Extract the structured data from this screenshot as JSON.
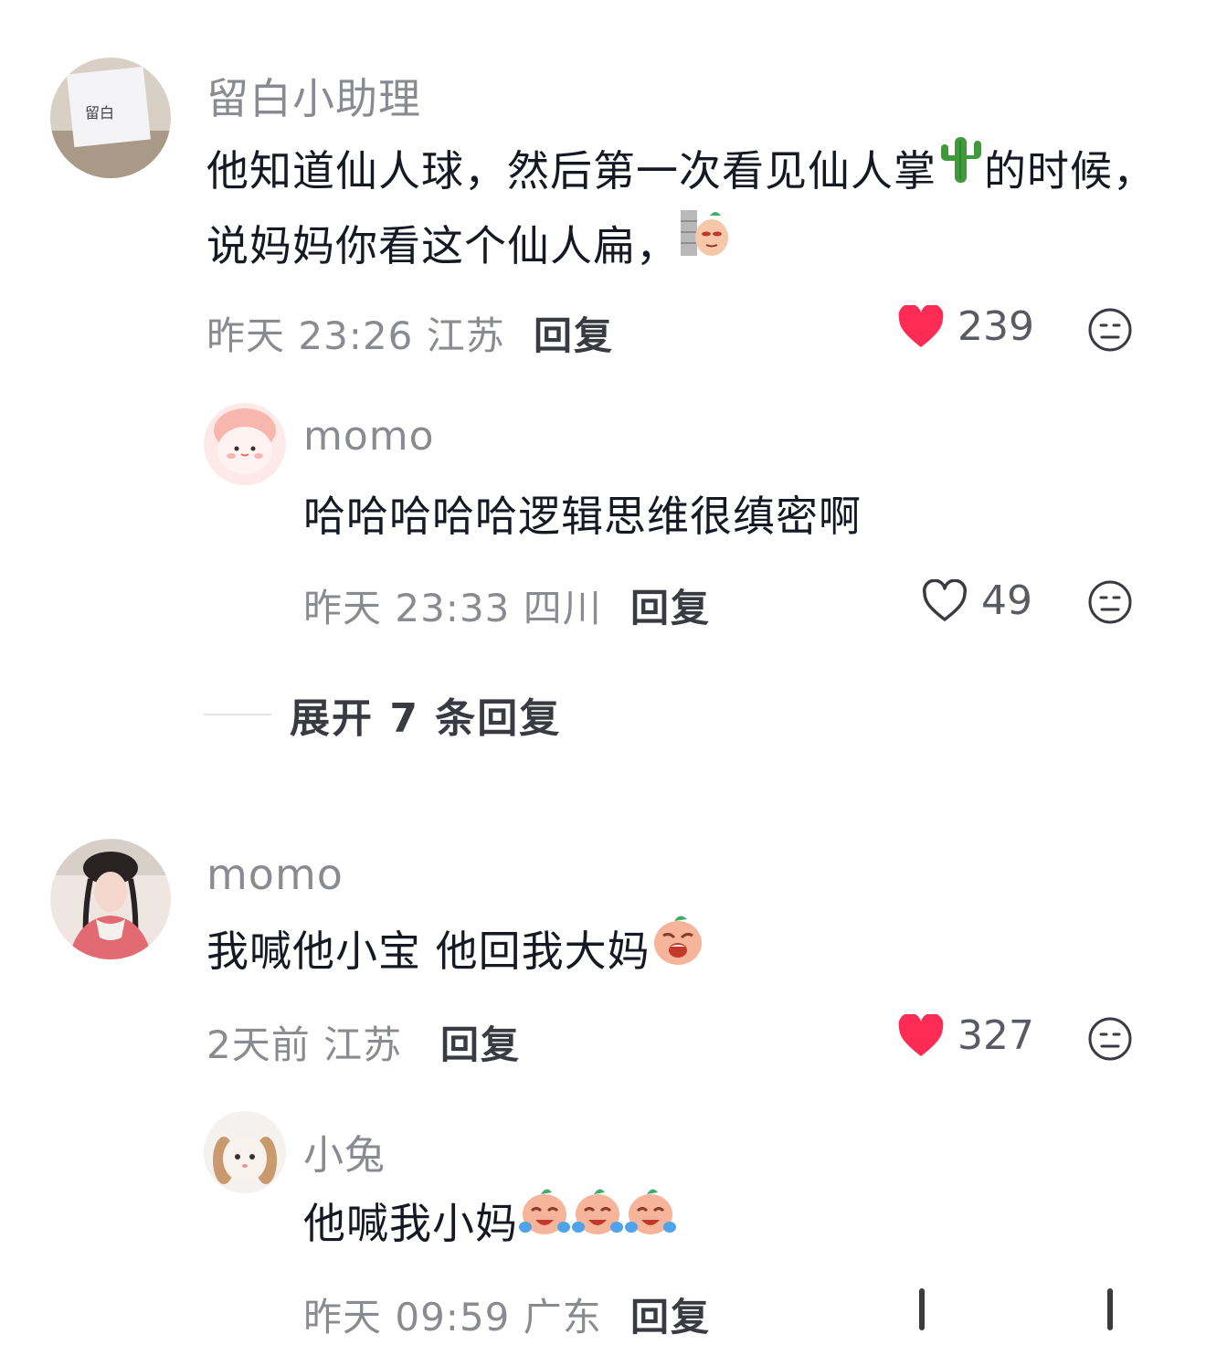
{
  "comments": [
    {
      "username": "留白小助理",
      "avatar_text": "留白",
      "content_part1": "他知道仙人球，然后第一次看见仙人掌",
      "content_part2": "的时候，说妈妈你看这个仙人扁，",
      "content_emoji_icons": [
        "cactus-emoji",
        "peeking-face-sticker"
      ],
      "meta": "昨天 23:26 江苏",
      "reply_label": "回复",
      "likes": "239",
      "liked": true,
      "replies": [
        {
          "username": "momo",
          "content": "哈哈哈哈哈逻辑思维很缜密啊",
          "meta": "昨天 23:33 四川",
          "reply_label": "回复",
          "likes": "49",
          "liked": false
        }
      ],
      "expand_label": "展开 7 条回复"
    },
    {
      "username": "momo",
      "content": "我喊他小宝 他回我大妈",
      "content_emoji_icons": [
        "crying-face-sticker"
      ],
      "meta": "2天前 江苏",
      "reply_label": "回复",
      "likes": "327",
      "liked": true,
      "replies": [
        {
          "username": "小兔",
          "content": "他喊我小妈",
          "content_emoji_icons": [
            "laugh-cry-sticker",
            "laugh-cry-sticker",
            "laugh-cry-sticker"
          ],
          "meta": "昨天 09:59 广东",
          "reply_label": "回复"
        }
      ]
    }
  ],
  "colors": {
    "like_red": "#fe2c55",
    "meta_gray": "#8a8b91",
    "text_dark": "#161823"
  }
}
